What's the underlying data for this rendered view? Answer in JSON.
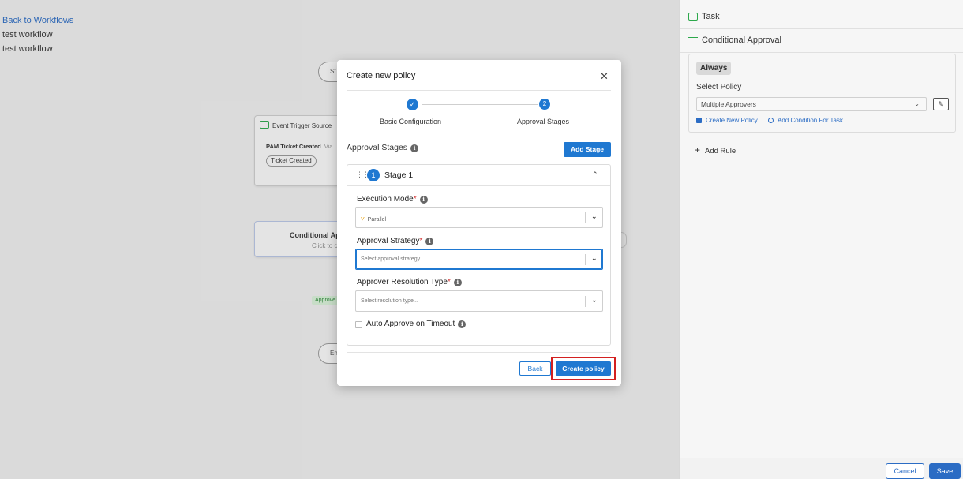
{
  "canvas": {
    "back_link": "Back to Workflows",
    "workflow_name": "test workflow",
    "workflow_desc": "test workflow",
    "start_node_label": "St",
    "trigger": {
      "title": "Event Trigger Source",
      "event_name": "PAM Ticket Created",
      "via": "Via",
      "chip": "Ticket Created"
    },
    "conditional": {
      "title": "Conditional Ap",
      "subtitle": "Click to c"
    },
    "approve_tag": "Approve",
    "end_node_label": "En"
  },
  "panel": {
    "task_label": "Task",
    "conditional_label": "Conditional Approval",
    "always_chip": "Always",
    "select_policy_label": "Select Policy",
    "policy_value": "Multiple Approvers",
    "create_policy_link": "Create New Policy",
    "add_condition_link": "Add Condition For Task",
    "add_rule": "Add Rule",
    "cancel": "Cancel",
    "save": "Save"
  },
  "modal": {
    "title": "Create new policy",
    "steps": [
      {
        "label": "Basic Configuration",
        "state": "complete"
      },
      {
        "label": "Approval Stages",
        "number": "2",
        "state": "active"
      }
    ],
    "section_title": "Approval Stages",
    "add_stage": "Add Stage",
    "stage": {
      "number": "1",
      "name": "Stage 1",
      "execution_mode_label": "Execution Mode",
      "execution_mode_value": "Parallel",
      "approval_strategy_label": "Approval Strategy",
      "approval_strategy_placeholder": "Select approval strategy...",
      "resolution_type_label": "Approver Resolution Type",
      "resolution_type_placeholder": "Select resolution type...",
      "auto_approve_label": "Auto Approve on Timeout"
    },
    "back": "Back",
    "create": "Create policy"
  },
  "colors": {
    "primary": "#1f78d1",
    "highlight": "#d32020",
    "success": "#2ba84a"
  }
}
